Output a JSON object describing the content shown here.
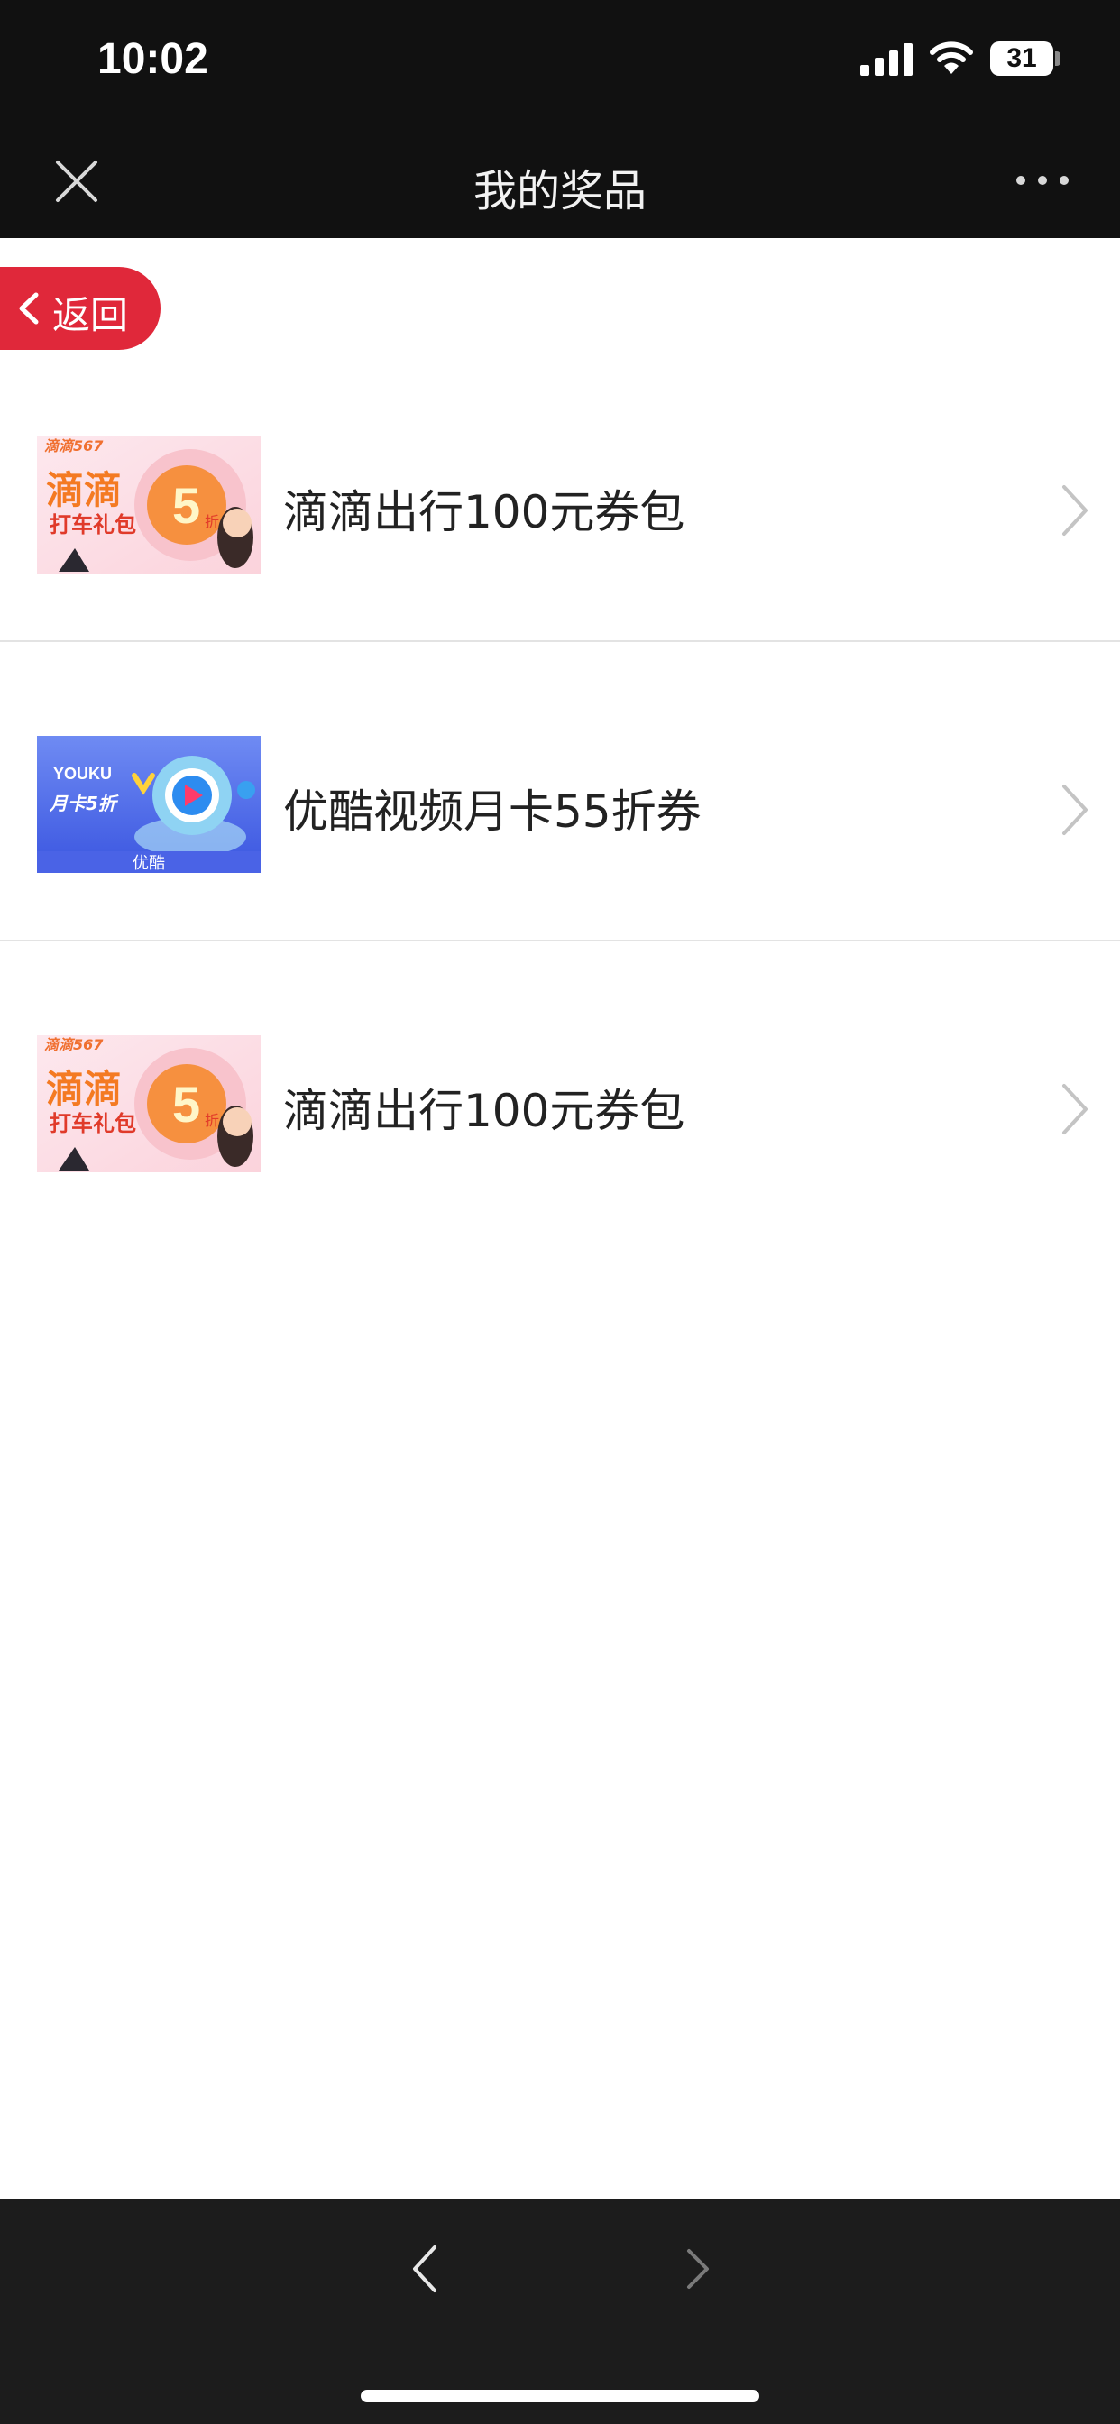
{
  "status_bar": {
    "time": "10:02",
    "battery": "31"
  },
  "nav": {
    "title": "我的奖品"
  },
  "back": {
    "label": "返回"
  },
  "items": [
    {
      "label": "滴滴出行100元券包",
      "thumb": {
        "brand": "滴滴567",
        "line1": "滴滴",
        "line2": "打车礼包",
        "badge": "5",
        "badge_unit": "折"
      }
    },
    {
      "label": "优酷视频月卡55折券",
      "thumb": {
        "brand": "YOUKU",
        "line1": "月卡5折",
        "caption": "优酷"
      }
    },
    {
      "label": "滴滴出行100元券包",
      "thumb": {
        "brand": "滴滴567",
        "line1": "滴滴",
        "line2": "打车礼包",
        "badge": "5",
        "badge_unit": "折"
      }
    }
  ],
  "colors": {
    "accent": "#e0283a",
    "topbar": "#111111",
    "bottombar": "#1c1c1c"
  }
}
